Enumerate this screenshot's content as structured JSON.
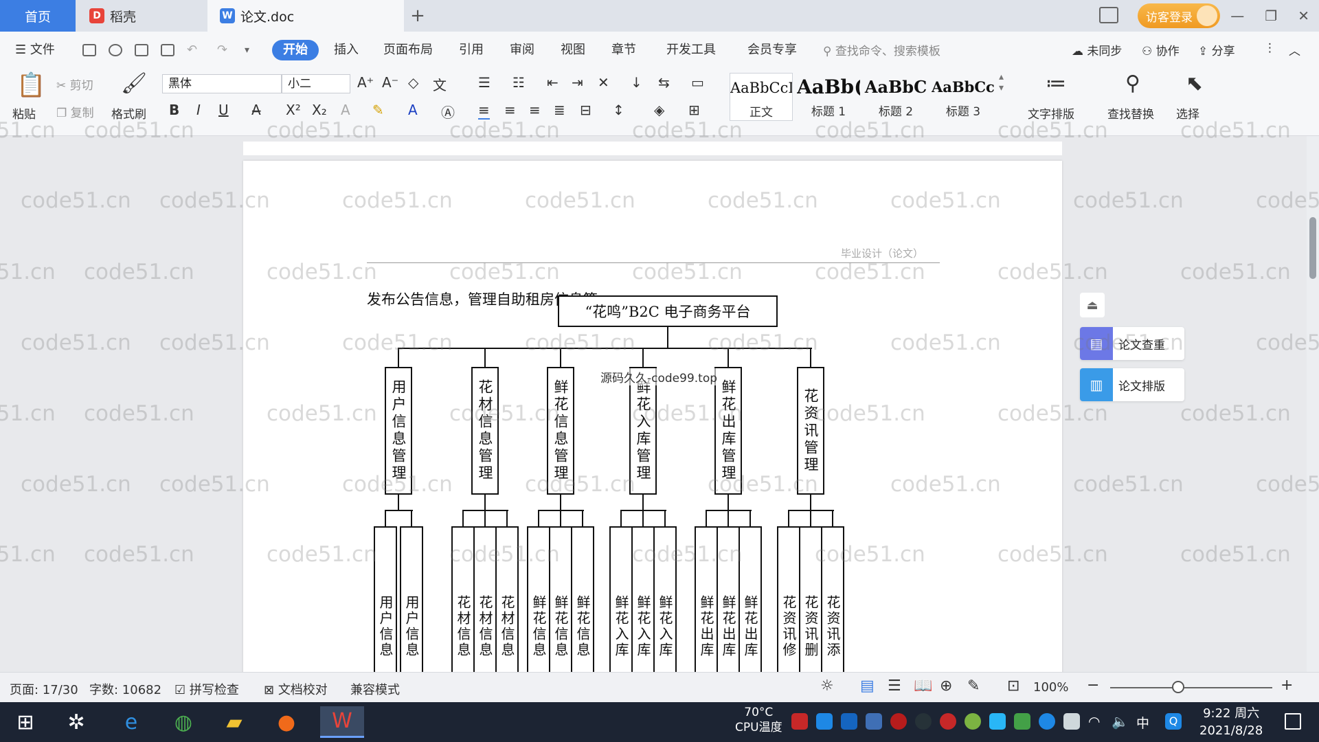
{
  "titlebar": {
    "tabs": [
      {
        "label": "首页"
      },
      {
        "label": "稻壳"
      },
      {
        "label": "论文.doc"
      }
    ],
    "add_tab": "+",
    "login_label": "访客登录"
  },
  "menubar": {
    "file_label": "文件",
    "items": [
      "开始",
      "插入",
      "页面布局",
      "引用",
      "审阅",
      "视图",
      "章节",
      "开发工具",
      "会员专享"
    ],
    "search_placeholder": "查找命令、搜索模板",
    "sync_label": "未同步",
    "collab_label": "协作",
    "share_label": "分享"
  },
  "ribbon": {
    "paste_label": "粘贴",
    "cut_label": "剪切",
    "copy_label": "复制",
    "format_painter_label": "格式刷",
    "font_name": "黑体",
    "font_size": "小二",
    "styles": [
      {
        "sample": "AaBbCcI",
        "name": "正文"
      },
      {
        "sample": "AaBb(",
        "name": "标题 1"
      },
      {
        "sample": "AaBbC",
        "name": "标题 2"
      },
      {
        "sample": "AaBbCcI",
        "name": "标题 3"
      }
    ],
    "text_layout_label": "文字排版",
    "find_replace_label": "查找替换",
    "select_label": "选择"
  },
  "document": {
    "header_text": "毕业设计（论文）",
    "body_text": "发布公告信息，管理自助租房信息等。",
    "overlay_text": "源码久久-code99.top",
    "chart": {
      "root": "“花鸣”B2C 电子商务平台",
      "modules": [
        {
          "label": "用户信息管理",
          "leaves": [
            "用户信息",
            "用户信息"
          ]
        },
        {
          "label": "花材信息管理",
          "leaves": [
            "花材信息",
            "花材信息",
            "花材信息"
          ]
        },
        {
          "label": "鲜花信息管理",
          "leaves": [
            "鲜花信息",
            "鲜花信息",
            "鲜花信息"
          ]
        },
        {
          "label": "鲜花入库管理",
          "leaves": [
            "鲜花入库",
            "鲜花入库",
            "鲜花入库"
          ]
        },
        {
          "label": "鲜花出库管理",
          "leaves": [
            "鲜花出库",
            "鲜花出库",
            "鲜花出库"
          ]
        },
        {
          "label": "花资讯管理",
          "leaves": [
            "花资讯修",
            "花资讯删",
            "花资讯添"
          ]
        }
      ]
    }
  },
  "side_panel": {
    "check_label": "论文查重",
    "layout_label": "论文排版"
  },
  "watermark": "code51.cn",
  "statusbar": {
    "page": "页面: 17/30",
    "words": "字数: 10682",
    "spell_check": "拼写检查",
    "proofread": "文档校对",
    "compat_mode": "兼容模式",
    "zoom": "100%"
  },
  "taskbar": {
    "temp": "70°C",
    "temp_label": "CPU温度",
    "time": "9:22 周六",
    "date": "2021/8/28",
    "ime": "中"
  },
  "colors": {
    "accent": "#3c7ee3",
    "login": "#f0a030",
    "taskbar": "#1c2433"
  }
}
